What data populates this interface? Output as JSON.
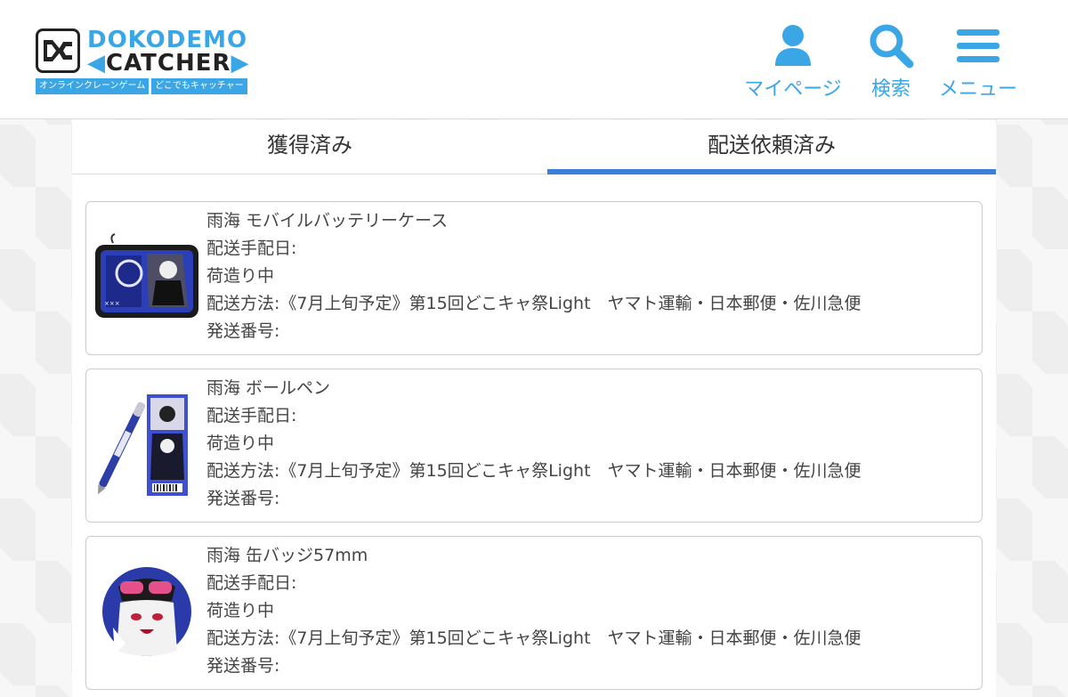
{
  "logo": {
    "title_line1": "DOKODEMO",
    "title_line2": "CATCHER",
    "tagline_left": "オンラインクレーンゲーム",
    "tagline_right": "どこでもキャッチャー"
  },
  "nav": {
    "mypage": {
      "label": "マイページ",
      "icon": "person-icon"
    },
    "search": {
      "label": "検索",
      "icon": "search-icon"
    },
    "menu": {
      "label": "メニュー",
      "icon": "hamburger-menu-icon"
    }
  },
  "tabs": [
    {
      "label": "獲得済み",
      "active": false
    },
    {
      "label": "配送依頼済み",
      "active": true
    }
  ],
  "items": [
    {
      "name": "雨海 モバイルバッテリーケース",
      "arrange_date": "配送手配日:",
      "status": "荷造り中",
      "method": "配送方法:《7月上旬予定》第15回どこキャ祭Light　ヤマト運輸・日本郵便・佐川急便",
      "tracking": "発送番号:",
      "image": "battery-case-thumbnail"
    },
    {
      "name": "雨海 ボールペン",
      "arrange_date": "配送手配日:",
      "status": "荷造り中",
      "method": "配送方法:《7月上旬予定》第15回どこキャ祭Light　ヤマト運輸・日本郵便・佐川急便",
      "tracking": "発送番号:",
      "image": "ballpoint-pen-thumbnail"
    },
    {
      "name": "雨海 缶バッジ57mm",
      "arrange_date": "配送手配日:",
      "status": "荷造り中",
      "method": "配送方法:《7月上旬予定》第15回どこキャ祭Light　ヤマト運輸・日本郵便・佐川急便",
      "tracking": "発送番号:",
      "image": "can-badge-thumbnail"
    }
  ],
  "colors": {
    "accent": "#3aa6e6",
    "tab_underline": "#3a7fd9"
  }
}
